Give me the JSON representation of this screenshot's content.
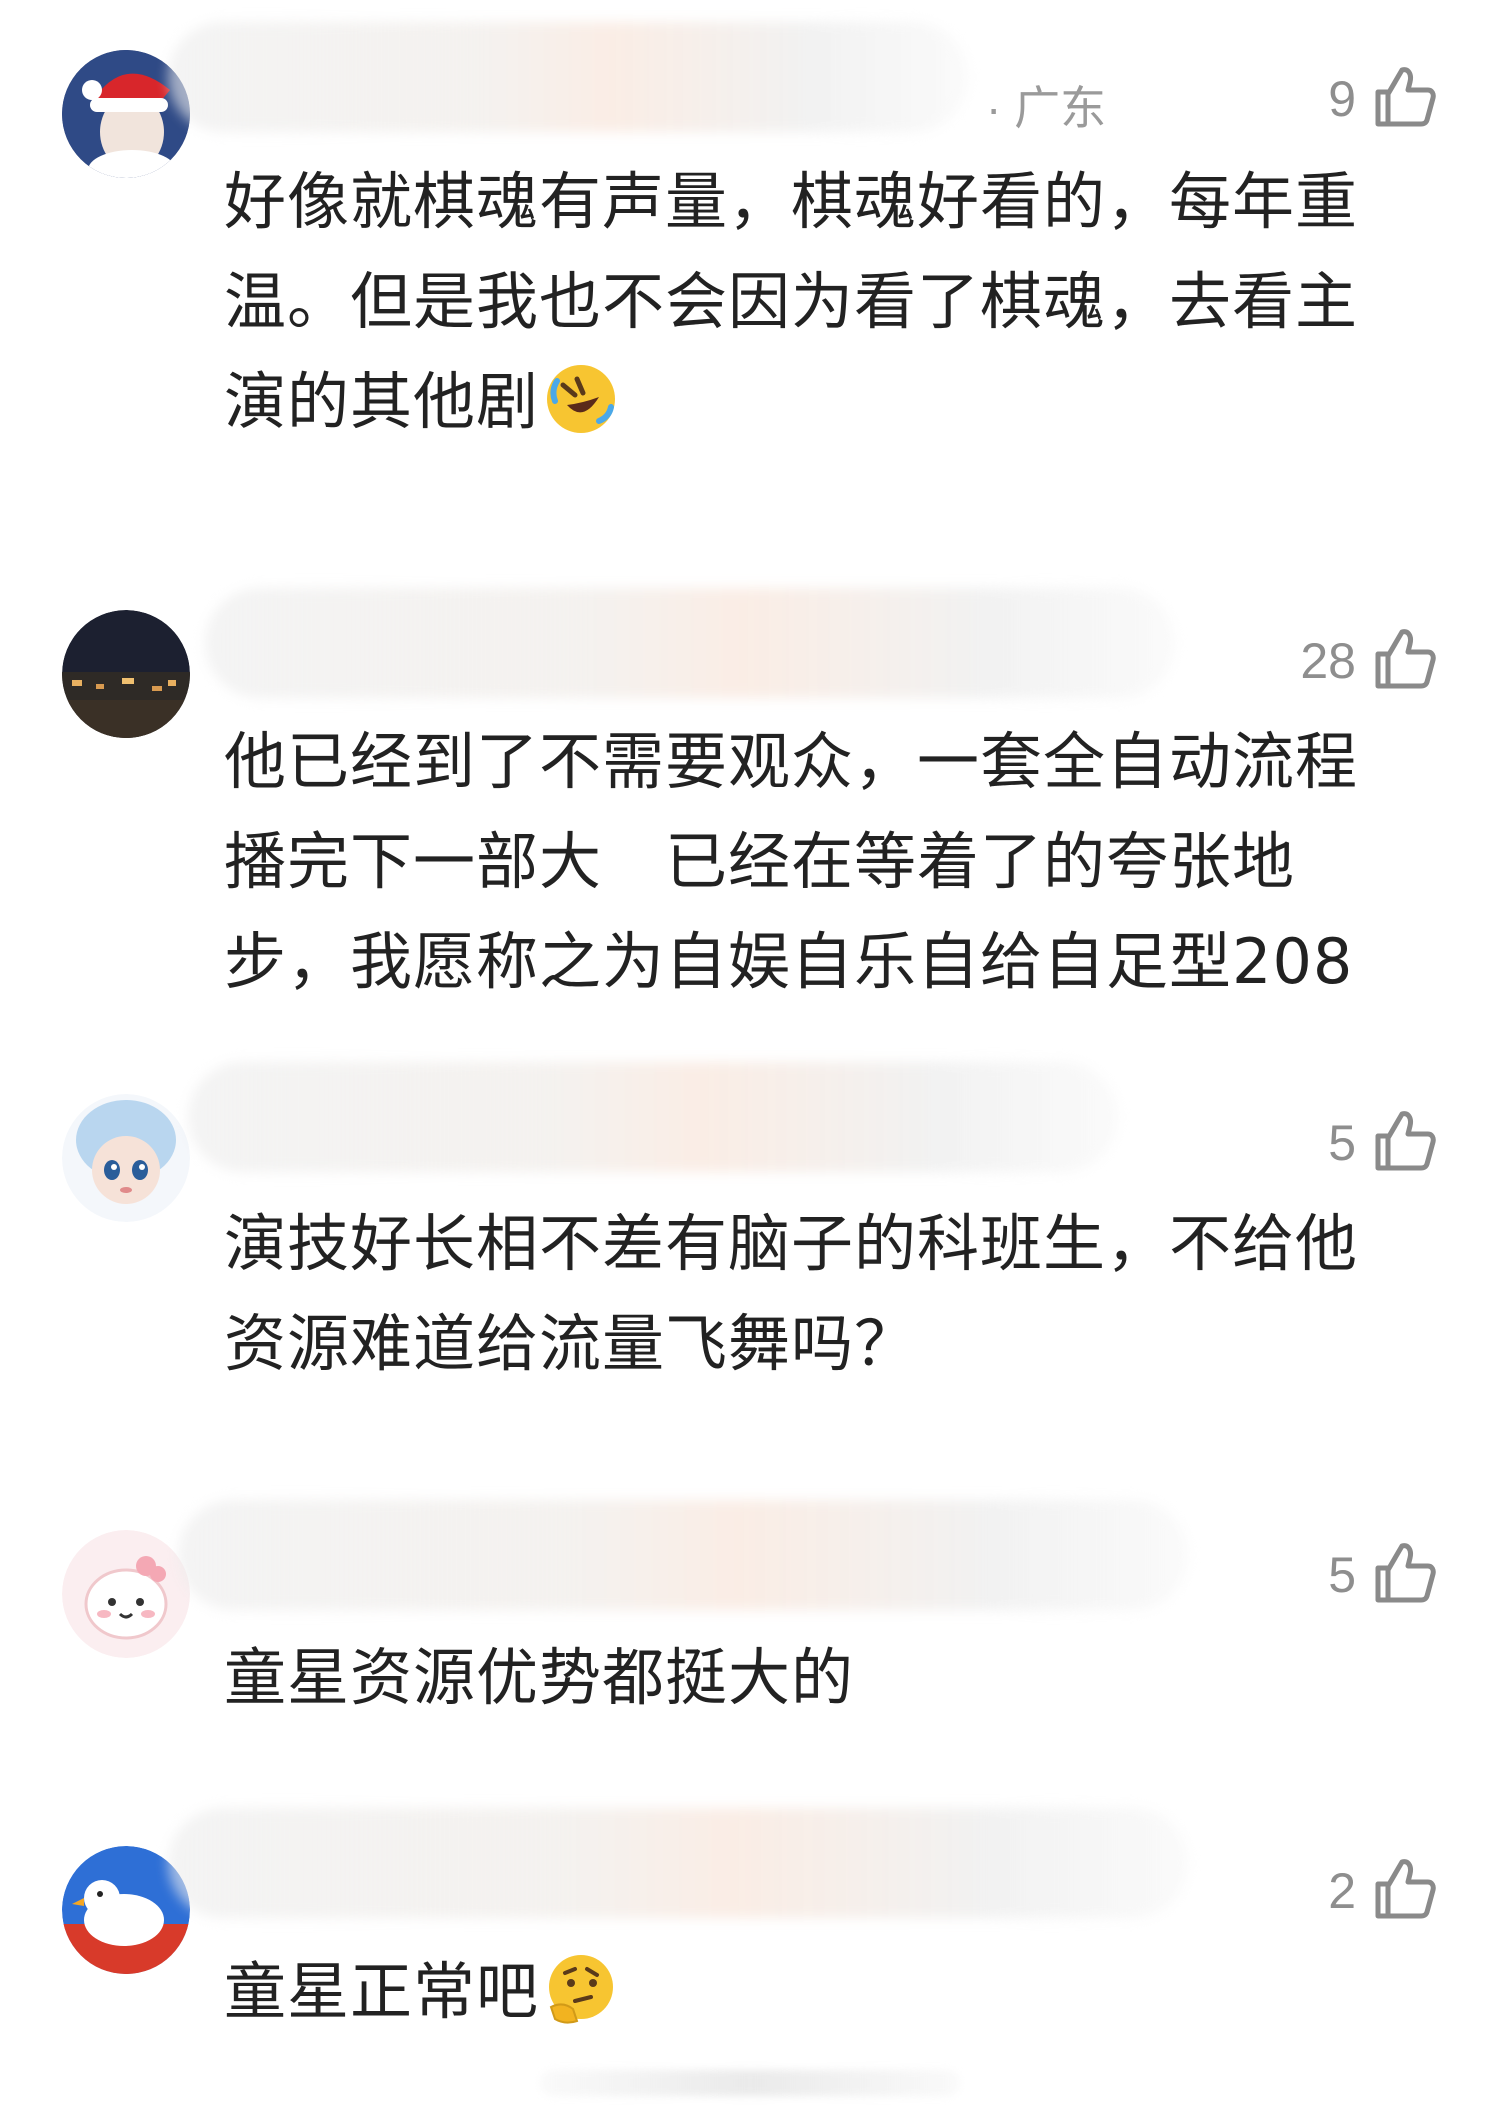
{
  "comments": [
    {
      "location": "· 广东",
      "likes": "9",
      "text_lines": [
        "好像就棋魂有声量，棋魂好看的，每年重",
        "温。但是我也不会因为看了棋魂，去看主",
        "演的其他剧"
      ],
      "emoji": "rolling-on-floor-laughing"
    },
    {
      "likes": "28",
      "text_lines": [
        "他已经到了不需要观众，一套全自动流程",
        "播完下一部大　已经在等着了的夸张地",
        "步，我愿称之为自娱自乐自给自足型208"
      ]
    },
    {
      "likes": "5",
      "text_lines": [
        "演技好长相不差有脑子的科班生，不给他",
        "资源难道给流量飞舞吗？"
      ]
    },
    {
      "likes": "5",
      "text_lines": [
        "童星资源优势都挺大的"
      ]
    },
    {
      "likes": "2",
      "text_lines": [
        "童星正常吧"
      ],
      "emoji": "thinking-face"
    }
  ],
  "icons": {
    "like": "thumbs-up-outline-icon"
  },
  "colors": {
    "text": "#222222",
    "meta": "#9a9a9a",
    "like": "#8e8e8e"
  }
}
